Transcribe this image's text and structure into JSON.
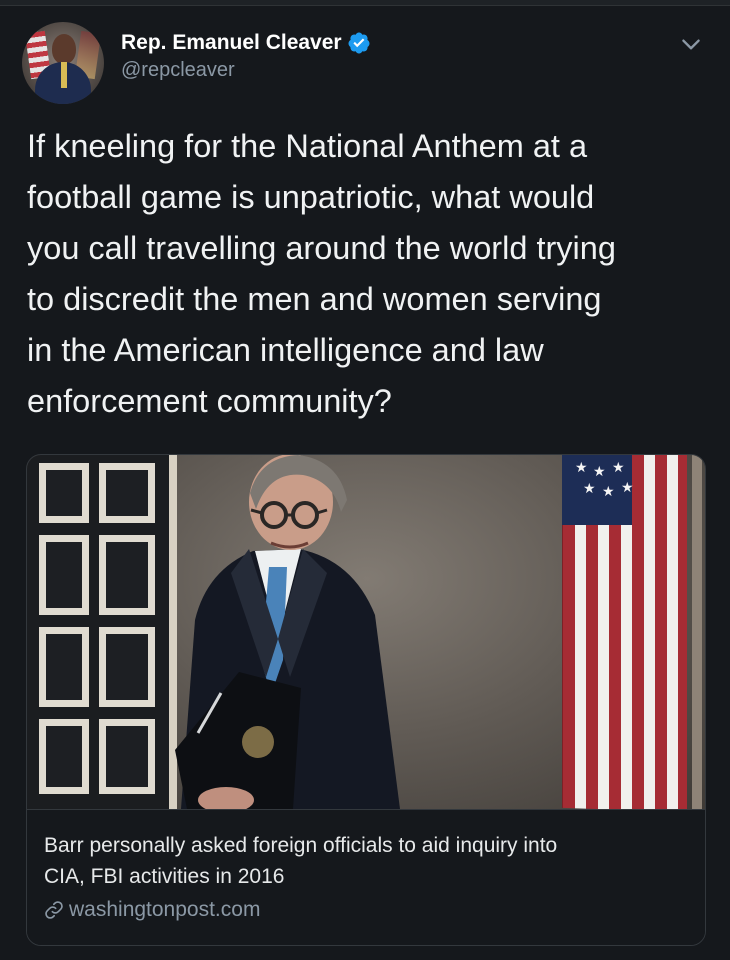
{
  "profile": {
    "name": "Rep. Emanuel Cleaver",
    "handle": "@repcleaver",
    "verified_icon": "verified-badge",
    "avatar_icon": "congressman-avatar"
  },
  "tweet": {
    "text": "If kneeling for the National Anthem at a\nfootball game is unpatriotic, what would\nyou call travelling around the world trying\nto discredit the men and women serving\nin the American intelligence and law\nenforcement community?"
  },
  "card": {
    "headline": "Barr personally asked foreign officials to aid inquiry into\nCIA, FBI activities in 2016",
    "domain": "washingtonpost.com",
    "link_icon": "link-icon"
  },
  "colors": {
    "background": "#15181c",
    "text": "#e7e9ea",
    "muted": "#8b98a5",
    "verified": "#1d9bf0",
    "border": "#33383d"
  }
}
